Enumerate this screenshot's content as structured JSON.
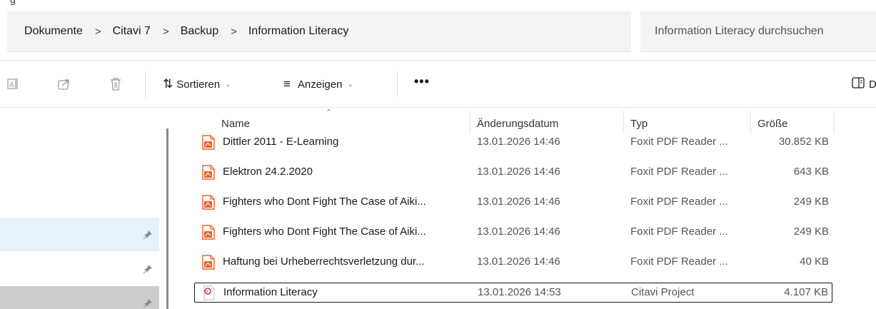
{
  "breadcrumb": {
    "items": [
      "Dokumente",
      "Citavi 7",
      "Backup",
      "Information Literacy"
    ],
    "separator": ">"
  },
  "search": {
    "placeholder": "Information Literacy durchsuchen"
  },
  "toolbar": {
    "sort_label": "Sortieren",
    "view_label": "Anzeigen",
    "more_label": "•••",
    "details_label": "D"
  },
  "columns": {
    "name": "Name",
    "date": "Änderungsdatum",
    "type": "Typ",
    "size": "Größe"
  },
  "files": [
    {
      "name": "Dittler 2011 - E-Learning",
      "date": "13.01.2026 14:46",
      "type": "Foxit PDF Reader ...",
      "size": "30.852 KB",
      "icon": "pdf-icon"
    },
    {
      "name": "Elektron 24.2.2020",
      "date": "13.01.2026 14:46",
      "type": "Foxit PDF Reader ...",
      "size": "643 KB",
      "icon": "pdf-icon"
    },
    {
      "name": "Fighters who Dont Fight The Case of Aiki...",
      "date": "13.01.2026 14:46",
      "type": "Foxit PDF Reader ...",
      "size": "249 KB",
      "icon": "pdf-icon"
    },
    {
      "name": "Fighters who Dont Fight The Case of Aiki...",
      "date": "13.01.2026 14:46",
      "type": "Foxit PDF Reader ...",
      "size": "249 KB",
      "icon": "pdf-icon"
    },
    {
      "name": "Haftung bei Urheberrechtsverletzung dur...",
      "date": "13.01.2026 14:46",
      "type": "Foxit PDF Reader ...",
      "size": "40 KB",
      "icon": "pdf-icon"
    },
    {
      "name": "Information Literacy",
      "date": "13.01.2026 14:53",
      "type": "Citavi Project",
      "size": "4.107 KB",
      "icon": "citavi-project-icon"
    }
  ],
  "colors": {
    "accent_selected": "#e5f1fb",
    "pdf_orange": "#e8622c",
    "citavi_red": "#d03131"
  }
}
